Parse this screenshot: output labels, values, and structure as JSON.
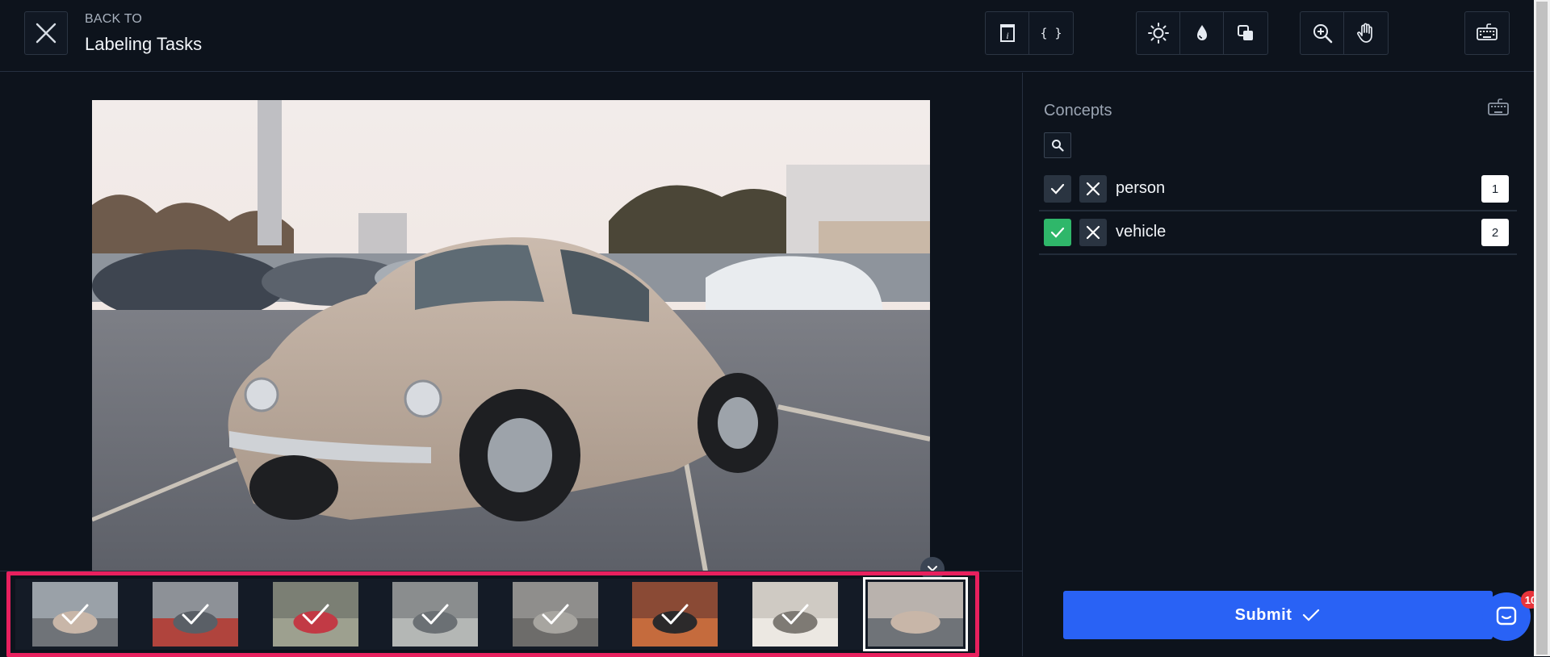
{
  "header": {
    "back_label": "BACK TO",
    "back_title": "Labeling Tasks",
    "toolbar_groups": [
      [
        "info-icon",
        "code-braces-icon"
      ],
      [
        "brightness-icon",
        "saturation-icon",
        "contrast-icon"
      ],
      [
        "zoom-in-icon",
        "pan-hand-icon"
      ],
      [
        "keyboard-icon"
      ]
    ],
    "code_glyph": "{ }"
  },
  "filmstrip": {
    "thumbnails": [
      {
        "name": "thumb-1",
        "checked": true,
        "selected": false
      },
      {
        "name": "thumb-2",
        "checked": true,
        "selected": false
      },
      {
        "name": "thumb-3",
        "checked": true,
        "selected": false
      },
      {
        "name": "thumb-4",
        "checked": true,
        "selected": false
      },
      {
        "name": "thumb-5",
        "checked": true,
        "selected": false
      },
      {
        "name": "thumb-6",
        "checked": true,
        "selected": false
      },
      {
        "name": "thumb-7",
        "checked": true,
        "selected": false
      },
      {
        "name": "thumb-8",
        "checked": false,
        "selected": true
      }
    ]
  },
  "panel": {
    "title": "Concepts",
    "concepts": [
      {
        "label": "person",
        "shortcut": "1",
        "accepted": false
      },
      {
        "label": "vehicle",
        "shortcut": "2",
        "accepted": true
      }
    ],
    "submit_label": "Submit"
  },
  "chat": {
    "badge_count": "10"
  },
  "colors": {
    "accent_blue": "#2962f5",
    "accept_green": "#2fb76a",
    "highlight_pink": "#e8205e",
    "background": "#0d131c"
  }
}
